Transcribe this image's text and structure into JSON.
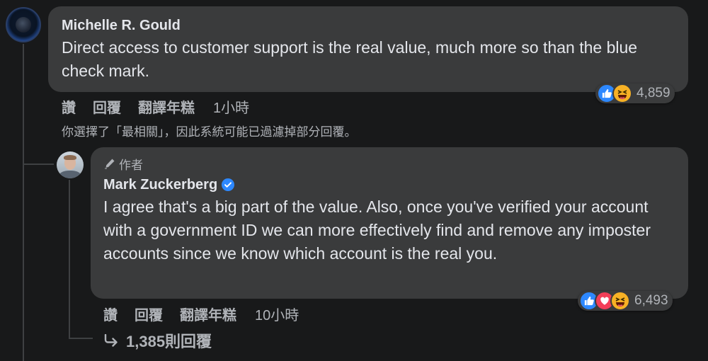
{
  "comment": {
    "author": "Michelle R. Gould",
    "text": "Direct access to customer support is the real value, much more so than the blue check mark.",
    "actions": {
      "like": "讚",
      "reply": "回覆",
      "translate": "翻譯年糕",
      "time": "1小時"
    },
    "reactions": {
      "icons": [
        "like-icon",
        "haha-icon"
      ],
      "count": "4,859"
    }
  },
  "filter_notice": "你選擇了「最相關」，因此系統可能已過濾掉部分回覆。",
  "reply": {
    "author_tag": "作者",
    "author": "Mark Zuckerberg",
    "text": "I agree that's a big part of the value. Also, once you've verified your account with a government ID we can more effectively find and remove any imposter accounts since we know which account is the real you.",
    "actions": {
      "like": "讚",
      "reply": "回覆",
      "translate": "翻譯年糕",
      "time": "10小時"
    },
    "reactions": {
      "icons": [
        "like-icon",
        "love-icon",
        "haha-icon"
      ],
      "count": "6,493"
    }
  },
  "more_replies": "1,385則回覆",
  "colors": {
    "background": "#18191a",
    "bubble": "#3a3b3c",
    "text_primary": "#e4e6eb",
    "text_secondary": "#b0b3b8",
    "verified": "#2d88ff"
  }
}
